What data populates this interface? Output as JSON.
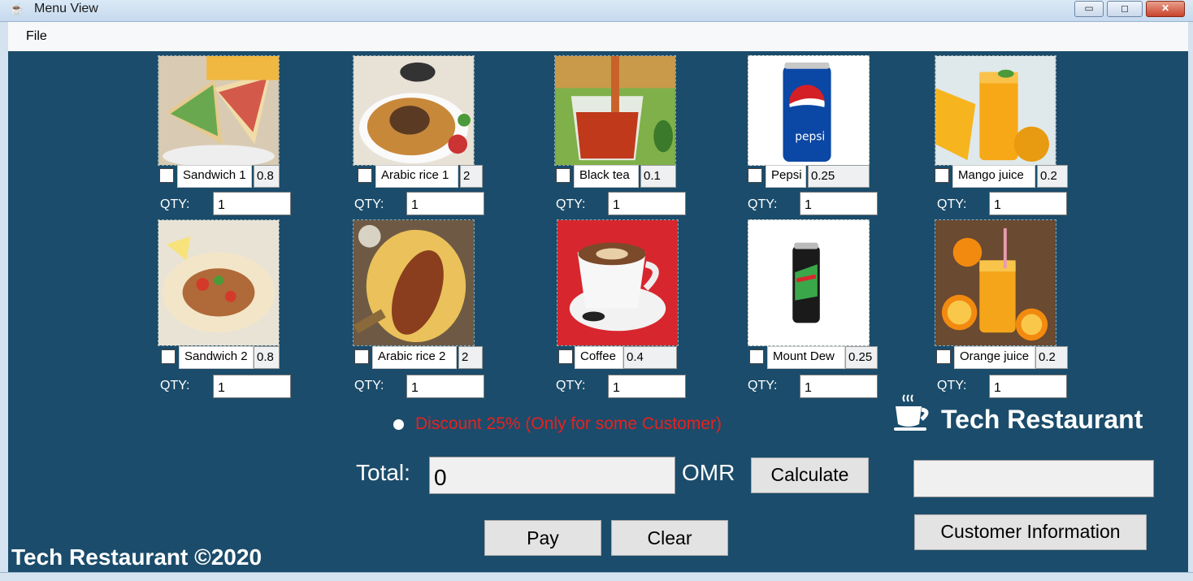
{
  "window": {
    "title": "Menu View",
    "minimize": "▭",
    "maximize": "◻",
    "close": "✕"
  },
  "menubar": {
    "file": "File"
  },
  "qty_label": "QTY:",
  "items": [
    {
      "name": "Sandwich 1",
      "price": "0.8",
      "qty": "1",
      "checked": false
    },
    {
      "name": "Arabic rice 1",
      "price": "2",
      "qty": "1",
      "checked": false
    },
    {
      "name": "Black tea",
      "price": "0.1",
      "qty": "1",
      "checked": false
    },
    {
      "name": "Pepsi",
      "price": "0.25",
      "qty": "1",
      "checked": false
    },
    {
      "name": "Mango juice",
      "price": "0.2",
      "qty": "1",
      "checked": false
    },
    {
      "name": "Sandwich 2",
      "price": "0.8",
      "qty": "1",
      "checked": false
    },
    {
      "name": "Arabic rice 2",
      "price": "2",
      "qty": "1",
      "checked": false
    },
    {
      "name": "Coffee",
      "price": "0.4",
      "qty": "1",
      "checked": false
    },
    {
      "name": "Mount Dew",
      "price": "0.25",
      "qty": "1",
      "checked": false
    },
    {
      "name": "Orange juice",
      "price": "0.2",
      "qty": "1",
      "checked": false
    }
  ],
  "discount": {
    "label": "Discount 25% (Only for some Customer)",
    "selected": false,
    "color": "#e8211e"
  },
  "total": {
    "label": "Total:",
    "value": "0",
    "currency": "OMR"
  },
  "buttons": {
    "calculate": "Calculate",
    "pay": "Pay",
    "clear": "Clear",
    "customer_information": "Customer Information"
  },
  "customer_field": {
    "value": ""
  },
  "logo": {
    "text": "Tech Restaurant",
    "icon": "coffee-cup-icon"
  },
  "footer": "Tech Restaurant ©2020",
  "colors": {
    "background": "#1b4c6b",
    "accent_red": "#e8211e"
  }
}
